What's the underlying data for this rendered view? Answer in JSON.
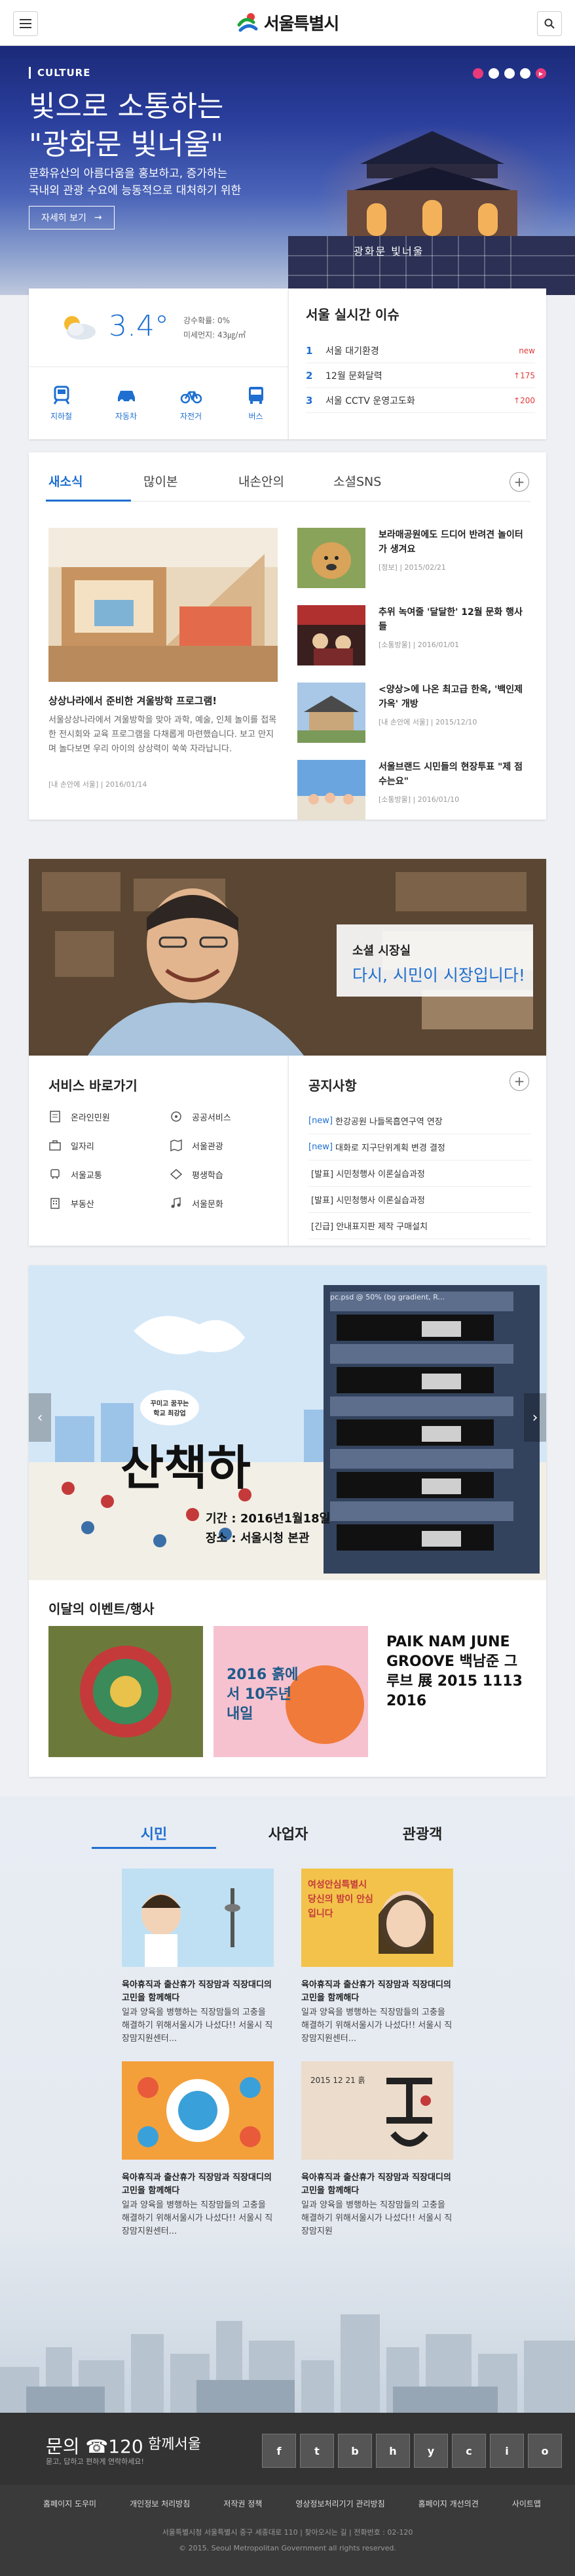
{
  "header": {
    "logo_text": "서울특별시",
    "menu_icon": "hamburger-icon",
    "search_icon": "search-icon"
  },
  "hero": {
    "category": "CULTURE",
    "title_line1": "빛으로 소통하는",
    "title_line2": "\"광화문 빛너울\"",
    "desc_line1": "문화유산의 아름다움을 홍보하고, 증가하는",
    "desc_line2": "국내외 관광 수요에 능동적으로 대처하기 위한",
    "more_label": "자세히 보기",
    "caption": "광화문 빛너울"
  },
  "weather": {
    "temp": "3.4°",
    "rain": "강수확률: 0%",
    "dust": "미세먼지: 43㎍/㎥",
    "icon": "partly-cloudy-icon"
  },
  "traffic": [
    {
      "label": "지하철",
      "icon": "subway-icon"
    },
    {
      "label": "자동차",
      "icon": "car-icon"
    },
    {
      "label": "자전거",
      "icon": "bicycle-icon"
    },
    {
      "label": "버스",
      "icon": "bus-icon"
    }
  ],
  "issue": {
    "title": "서울 실시간 이슈",
    "items": [
      {
        "rank": "1",
        "keyword": "서울 대기환경",
        "status": "new"
      },
      {
        "rank": "2",
        "keyword": "12월 문화달력",
        "status": "↑175"
      },
      {
        "rank": "3",
        "keyword": "서울 CCTV 운영고도화",
        "status": "↑200"
      }
    ]
  },
  "news": {
    "tabs": [
      "새소식",
      "많이본",
      "내손안의",
      "소셜SNS"
    ],
    "featured": {
      "title": "상상나라에서 준비한 겨울방학 프로그램!",
      "desc": "서울상상나라에서 겨울방학을 맞아 과학, 예술, 인체 놀이를 접목한 전시회와 교육 프로그램을 다채롭게 마련했습니다. 보고 만지며 놀다보면 우리 아이의 상상력이 쑥쑥 자라납니다.",
      "meta": "[내 손안에 서울]  |  2016/01/14"
    },
    "items": [
      {
        "title": "보라매공원에도 드디어 반려견 놀이터가 생겨요",
        "meta": "[정보]  |  2015/02/21"
      },
      {
        "title": "추위 녹여줄 '달달한' 12월 문화 행사들",
        "meta": "[소통방울]  |  2016/01/01"
      },
      {
        "title": "<양상>에 나온 최고급 한옥, '백인제 가옥' 개방",
        "meta": "[내 손안에 서울]  |  2015/12/10"
      },
      {
        "title": "서울브랜드 시민들의 현장투표 \"제 점수는요\"",
        "meta": "[소통방울]  |  2016/01/10"
      }
    ]
  },
  "mayor": {
    "sub": "소셜 시장실",
    "main": "다시, 시민이 시장입니다!"
  },
  "services": {
    "title": "서비스 바로가기",
    "items": [
      {
        "label": "온라인민원",
        "icon": "document-icon"
      },
      {
        "label": "공공서비스",
        "icon": "public-service-icon"
      },
      {
        "label": "일자리",
        "icon": "briefcase-icon"
      },
      {
        "label": "서울관광",
        "icon": "map-icon"
      },
      {
        "label": "서울교통",
        "icon": "traffic-icon"
      },
      {
        "label": "평생학습",
        "icon": "learning-icon"
      },
      {
        "label": "부동산",
        "icon": "building-icon"
      },
      {
        "label": "서울문화",
        "icon": "music-icon"
      }
    ]
  },
  "notice": {
    "title": "공지사항",
    "items": [
      {
        "tag": "[new]",
        "text": "한강공원 나들목흡연구역 연장"
      },
      {
        "tag": "[new]",
        "text": "대화로 지구단위계획 변경 결정"
      },
      {
        "tag": "",
        "text": "[발표] 시민청행사 이론실습과정"
      },
      {
        "tag": "",
        "text": "[발표] 시민청행사 이론실습과정"
      },
      {
        "tag": "",
        "text": "[긴급] 안내표지판 제작 구매설치"
      }
    ]
  },
  "event_banner": {
    "badge_line1": "꾸미고 꿈꾸는",
    "badge_line2": "학교 최강업",
    "title": "산책하",
    "period": "기간 : 2016년1월18일",
    "place": "장소 : 서울시청 본관",
    "layer_label": "pc.psd @ 50% (bg gradient, R..."
  },
  "events": {
    "title": "이달의 이벤트/행사",
    "posters": [
      {
        "text": ""
      },
      {
        "text": "2016 흙에서 10주년 내일"
      },
      {
        "text": "PAIK NAM JUNE GROOVE 백남준 그루브 展 2015 1113 2016"
      }
    ]
  },
  "citizen": {
    "tabs": [
      "시민",
      "사업자",
      "관광객"
    ],
    "items": [
      {
        "title": "육아휴직과 출산휴가 직장맘과 직장대디의 고민을 함께해다",
        "desc": "일과 양육을 병행하는 직장맘들의 고충을 해결하기 위해서울시가 나섰다!! 서울시 직장맘지원센터..."
      },
      {
        "title": "육아휴직과 출산휴가 직장맘과 직장대디의 고민을 함께해다",
        "desc": "일과 양육을 병행하는 직장맘들의 고충을 해결하기 위해서울시가 나섰다!! 서울시 직장맘지원센터..."
      },
      {
        "title": "육아휴직과 출산휴가 직장맘과 직장대디의 고민을 함께해다",
        "desc": "일과 양육을 병행하는 직장맘들의 고충을 해결하기 위해서울시가 나섰다!! 서울시 직장맘지원센터..."
      },
      {
        "title": "육아휴직과 출산휴가 직장맘과 직장대디의 고민을 함께해다",
        "desc": "일과 양육을 병행하는 직장맘들의 고충을 해결하기 위해서울시가 나섰다!! 서울시 직장맘지원"
      }
    ],
    "poster2_text": "여성안심특별시 당신의 밤이 안심입니다",
    "poster4_text": "2015 12 21 흙"
  },
  "footer": {
    "call_title": "문의 ☎120",
    "call_sub": "묻고, 답하고 편하게 연락하세요!",
    "together": "함께서울",
    "sns": [
      "f",
      "t",
      "b",
      "h",
      "y",
      "c",
      "i",
      "o"
    ],
    "links": [
      "홈페이지 도우미",
      "개인정보 처리방침",
      "저작권 정책",
      "영상정보처리기기 관리방침",
      "홈페이지 개선의견",
      "사이트맵"
    ],
    "address": "서울특별시청 서울특별시 중구 세종대로 110  |  찾아오시는 길  |  전화번호 : 02-120",
    "copyright": "© 2015. Seoul Metropolitan Government all rights reserved."
  }
}
